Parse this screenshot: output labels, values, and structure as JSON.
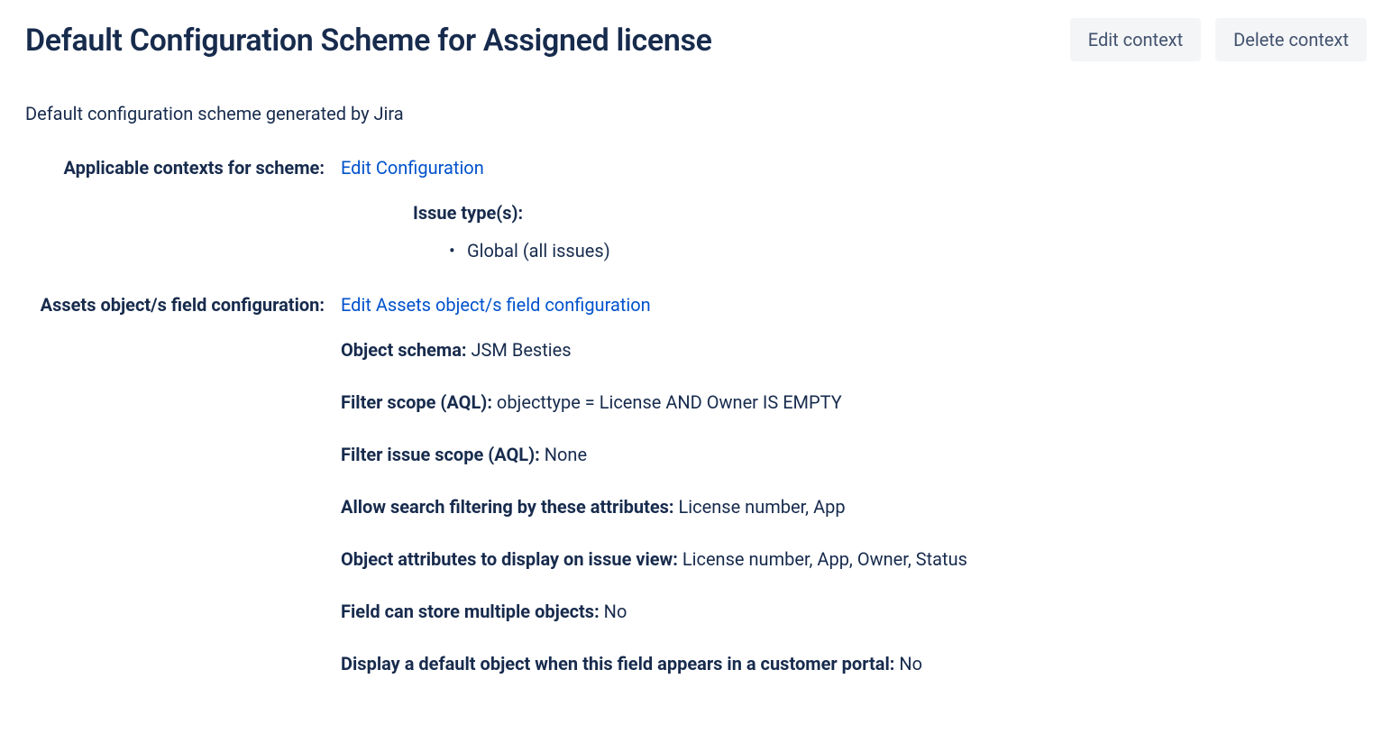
{
  "header": {
    "title": "Default Configuration Scheme for Assigned license",
    "edit_button": "Edit context",
    "delete_button": "Delete context"
  },
  "description": "Default configuration scheme generated by Jira",
  "contexts": {
    "label": "Applicable contexts for scheme:",
    "edit_link": "Edit Configuration",
    "issue_types_heading": "Issue type(s):",
    "issue_types_item": "Global (all issues)"
  },
  "assets": {
    "label": "Assets object/s field configuration:",
    "edit_link": "Edit Assets object/s field configuration",
    "details": [
      {
        "label": "Object schema:",
        "value": "JSM Besties"
      },
      {
        "label": "Filter scope (AQL):",
        "value": "objecttype = License AND Owner IS EMPTY"
      },
      {
        "label": "Filter issue scope (AQL):",
        "value": "None"
      },
      {
        "label": "Allow search filtering by these attributes:",
        "value": "License number, App"
      },
      {
        "label": "Object attributes to display on issue view:",
        "value": "License number, App, Owner, Status"
      },
      {
        "label": "Field can store multiple objects:",
        "value": "No"
      },
      {
        "label": "Display a default object when this field appears in a customer portal:",
        "value": "No"
      }
    ]
  }
}
